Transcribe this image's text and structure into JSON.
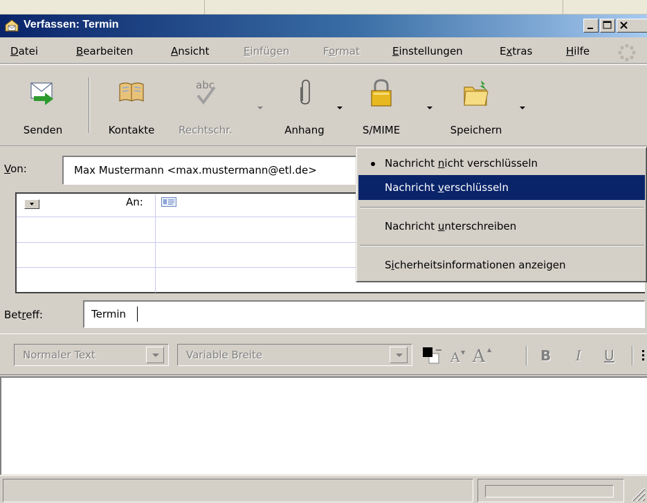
{
  "window": {
    "title": "Verfassen: Termin"
  },
  "menubar": {
    "items": [
      {
        "pre": "",
        "key": "D",
        "post": "atei",
        "disabled": false
      },
      {
        "pre": "",
        "key": "B",
        "post": "earbeiten",
        "disabled": false
      },
      {
        "pre": "",
        "key": "A",
        "post": "nsicht",
        "disabled": false
      },
      {
        "pre": "",
        "key": "E",
        "post": "infügen",
        "disabled": true
      },
      {
        "pre": "F",
        "key": "o",
        "post": "rmat",
        "disabled": true
      },
      {
        "pre": "",
        "key": "E",
        "post": "instellungen",
        "disabled": false
      },
      {
        "pre": "E",
        "key": "x",
        "post": "tras",
        "disabled": false
      },
      {
        "pre": "",
        "key": "H",
        "post": "ilfe",
        "disabled": false
      }
    ]
  },
  "toolbar": {
    "send": "Senden",
    "contacts": "Kontakte",
    "spell": "Rechtschr.",
    "attach": "Anhang",
    "smime": "S/MIME",
    "save": "Speichern",
    "spell_icon_text": "abc"
  },
  "header": {
    "from_label_key": "V",
    "from_label_rest": "on:",
    "from_value": "Max Mustermann <max.mustermann@etl.de>",
    "recipient_type": "An:",
    "subject_label_pre": "Bet",
    "subject_label_key": "r",
    "subject_label_post": "eff:",
    "subject_value": "Termin"
  },
  "format": {
    "paragraph_style": "Normaler Text",
    "font": "Variable Breite",
    "smaller_glyph": "A",
    "larger_glyph": "A",
    "bold": "B",
    "italic": "I",
    "underline": "U"
  },
  "smime_menu": {
    "items": [
      {
        "pre": "Nachricht ",
        "key": "n",
        "post": "icht verschlüsseln",
        "checked": true,
        "highlighted": false
      },
      {
        "pre": "Nachricht ",
        "key": "v",
        "post": "erschlüsseln",
        "checked": false,
        "highlighted": true
      },
      {
        "pre": "Nachricht ",
        "key": "u",
        "post": "nterschreiben",
        "checked": false,
        "highlighted": false
      },
      {
        "pre": "S",
        "key": "i",
        "post": "cherheitsinformationen anzeigen",
        "checked": false,
        "highlighted": false
      }
    ]
  },
  "colors": {
    "title_gradient_start": "#0a246a",
    "title_gradient_end": "#a6caf0",
    "highlight": "#0a246a",
    "face": "#d4d0c8"
  }
}
